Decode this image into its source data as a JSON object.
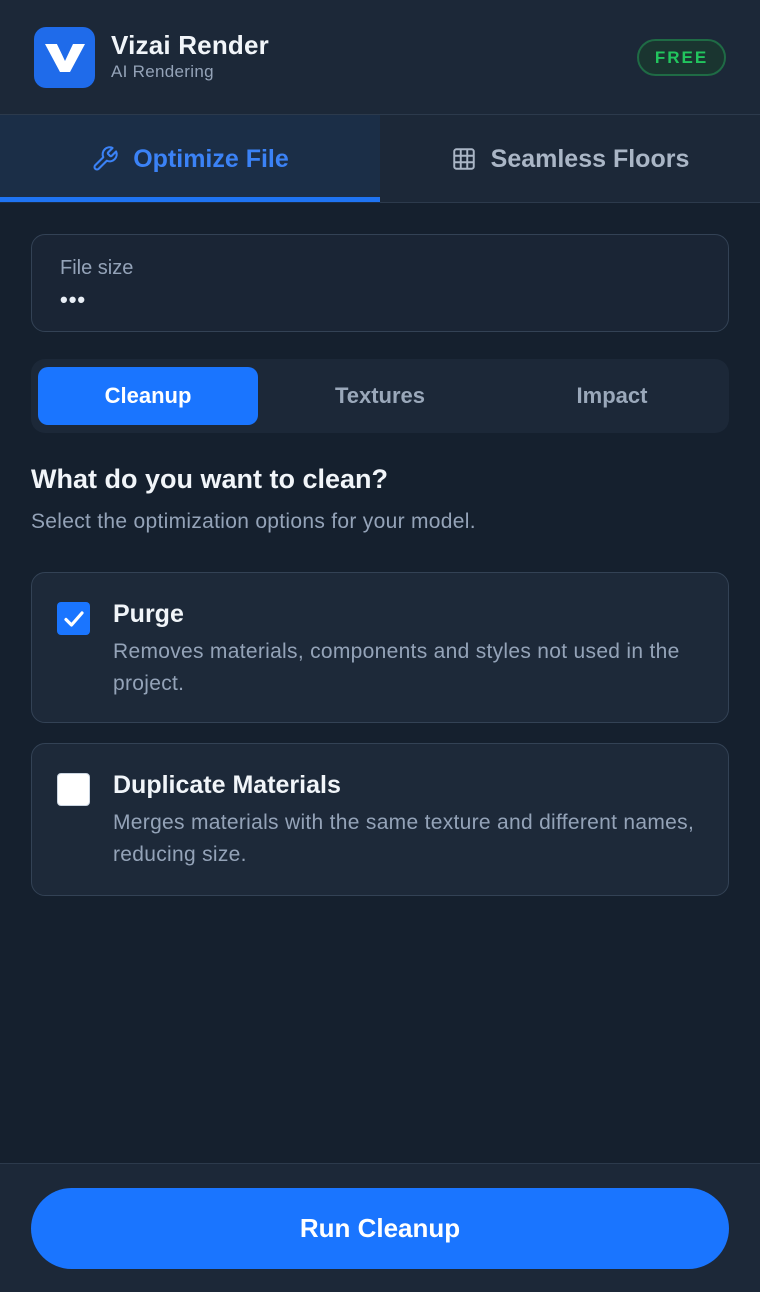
{
  "app": {
    "name": "Vizai Render",
    "subtitle": "AI Rendering",
    "plan_badge": "FREE",
    "logo_icon": "vizai-logo-icon"
  },
  "main_tabs": [
    {
      "label": "Optimize File",
      "icon": "wrench-icon",
      "active": true
    },
    {
      "label": "Seamless Floors",
      "icon": "grid-icon",
      "active": false
    }
  ],
  "file_size": {
    "label": "File size",
    "value": "•••"
  },
  "sub_tabs": [
    {
      "label": "Cleanup",
      "active": true
    },
    {
      "label": "Textures",
      "active": false
    },
    {
      "label": "Impact",
      "active": false
    }
  ],
  "section": {
    "title": "What do you want to clean?",
    "subtitle": "Select the optimization options for your model."
  },
  "options": [
    {
      "title": "Purge",
      "description": "Removes materials, components and styles not used in the project.",
      "checked": true
    },
    {
      "title": "Duplicate Materials",
      "description": "Merges materials with the same texture and different names, reducing size.",
      "checked": false
    }
  ],
  "footer": {
    "run_label": "Run Cleanup"
  },
  "colors": {
    "accent": "#1a75ff",
    "background": "#15202e",
    "panel": "#1c2838",
    "badge_green": "#22c55e"
  }
}
